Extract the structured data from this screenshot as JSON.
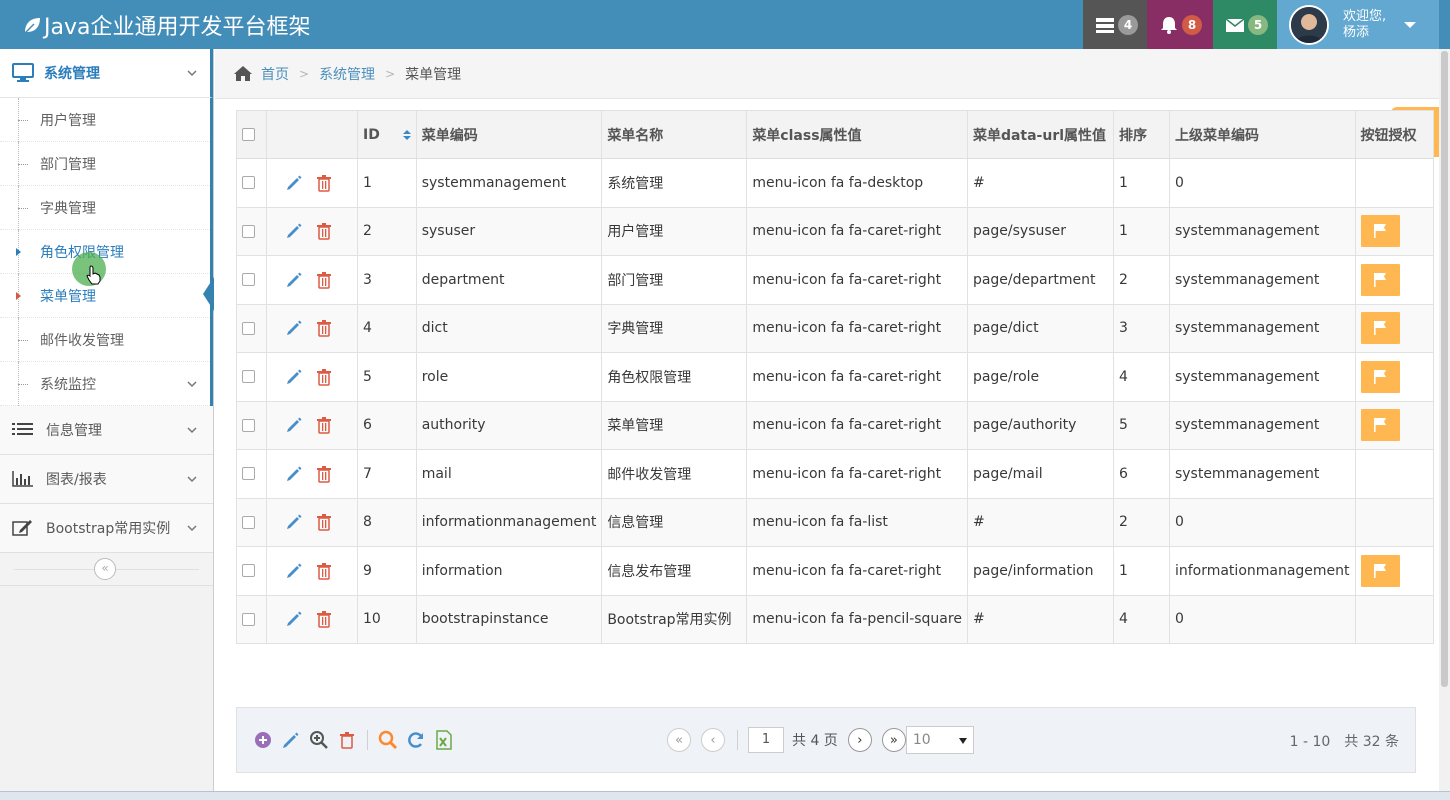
{
  "app": {
    "title": "Java企业通用开发平台框架"
  },
  "navbar": {
    "tasks_count": "4",
    "notifications_count": "8",
    "messages_count": "5",
    "welcome_line1": "欢迎您,",
    "user_name": "杨添"
  },
  "sidebar": {
    "active_group": "系统管理",
    "sub_items": [
      {
        "label": "用户管理"
      },
      {
        "label": "部门管理"
      },
      {
        "label": "字典管理"
      },
      {
        "label": "角色权限管理"
      },
      {
        "label": "菜单管理"
      },
      {
        "label": "邮件收发管理"
      },
      {
        "label": "系统监控"
      }
    ],
    "groups": [
      {
        "label": "信息管理",
        "icon": "list-icon"
      },
      {
        "label": "图表/报表",
        "icon": "bar-chart-icon"
      },
      {
        "label": "Bootstrap常用实例",
        "icon": "edit-icon"
      }
    ],
    "collapse_glyph": "«"
  },
  "breadcrumb": {
    "home": "首页",
    "section": "系统管理",
    "current": "菜单管理"
  },
  "table": {
    "columns": {
      "id": "ID",
      "code": "菜单编码",
      "name": "菜单名称",
      "class": "菜单class属性值",
      "url": "菜单data-url属性值",
      "order": "排序",
      "parent": "上级菜单编码",
      "auth": "按钮授权"
    },
    "rows": [
      {
        "id": "1",
        "code": "systemmanagement",
        "name": "系统管理",
        "class": "menu-icon fa fa-desktop",
        "url": "#",
        "order": "1",
        "parent": "0",
        "auth": false
      },
      {
        "id": "2",
        "code": "sysuser",
        "name": "用户管理",
        "class": "menu-icon fa fa-caret-right",
        "url": "page/sysuser",
        "order": "1",
        "parent": "systemmanagement",
        "auth": true
      },
      {
        "id": "3",
        "code": "department",
        "name": "部门管理",
        "class": "menu-icon fa fa-caret-right",
        "url": "page/department",
        "order": "2",
        "parent": "systemmanagement",
        "auth": true
      },
      {
        "id": "4",
        "code": "dict",
        "name": "字典管理",
        "class": "menu-icon fa fa-caret-right",
        "url": "page/dict",
        "order": "3",
        "parent": "systemmanagement",
        "auth": true
      },
      {
        "id": "5",
        "code": "role",
        "name": "角色权限管理",
        "class": "menu-icon fa fa-caret-right",
        "url": "page/role",
        "order": "4",
        "parent": "systemmanagement",
        "auth": true
      },
      {
        "id": "6",
        "code": "authority",
        "name": "菜单管理",
        "class": "menu-icon fa fa-caret-right",
        "url": "page/authority",
        "order": "5",
        "parent": "systemmanagement",
        "auth": true
      },
      {
        "id": "7",
        "code": "mail",
        "name": "邮件收发管理",
        "class": "menu-icon fa fa-caret-right",
        "url": "page/mail",
        "order": "6",
        "parent": "systemmanagement",
        "auth": false
      },
      {
        "id": "8",
        "code": "informationmanagement",
        "name": "信息管理",
        "class": "menu-icon fa fa-list",
        "url": "#",
        "order": "2",
        "parent": "0",
        "auth": false
      },
      {
        "id": "9",
        "code": "information",
        "name": "信息发布管理",
        "class": "menu-icon fa fa-caret-right",
        "url": "page/information",
        "order": "1",
        "parent": "informationmanagement",
        "auth": true
      },
      {
        "id": "10",
        "code": "bootstrapinstance",
        "name": "Bootstrap常用实例",
        "class": "menu-icon fa fa-pencil-square",
        "url": "#",
        "order": "4",
        "parent": "0",
        "auth": false
      }
    ]
  },
  "pager": {
    "first": "«",
    "prev": "‹",
    "next": "›",
    "last": "»",
    "current_page": "1",
    "total_pages": "共 4 页",
    "page_size": "10",
    "summary": "1 - 10　共 32 条"
  },
  "colors": {
    "navbar": "#438eb9",
    "accent": "#2b7dbc",
    "warning": "#ffb752",
    "danger": "#d15b47"
  }
}
